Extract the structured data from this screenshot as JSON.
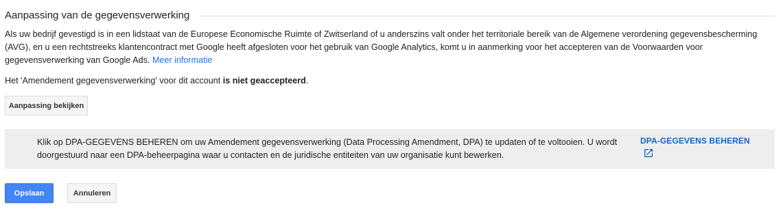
{
  "section": {
    "title": "Aanpassing van de gegevensverwerking"
  },
  "description": {
    "text": "Als uw bedrijf gevestigd is in een lidstaat van de Europese Economische Ruimte of Zwitserland of u anderszins valt onder het territoriale bereik van de Algemene verordening gegevensbescherming (AVG), en u een rechtstreeks klantencontract met Google heeft afgesloten voor het gebruik van Google Analytics, komt u in aanmerking voor het accepteren van de Voorwaarden voor gegevensverwerking van Google Ads.",
    "link_label": "Meer informatie"
  },
  "status": {
    "prefix": "Het 'Amendement gegevensverwerking' voor dit account",
    "value": "is niet geaccepteerd",
    "suffix": "."
  },
  "view_button": {
    "label": "Aanpassing bekijken"
  },
  "dpa_panel": {
    "text": "Klik op DPA-GEGEVENS BEHEREN om uw Amendement gegevensverwerking (Data Processing Amendment, DPA) te updaten of te voltooien. U wordt doorgestuurd naar een DPA-beheerpagina waar u contacten en de juridische entiteiten van uw organisatie kunt bewerken.",
    "link_label": "DPA-GEGEVENS BEHEREN",
    "link_icon": "open-in-new-icon",
    "link_color": "#1565c0"
  },
  "actions": {
    "save_label": "Opslaan",
    "cancel_label": "Annuleren",
    "save_color": "#4285f4"
  }
}
